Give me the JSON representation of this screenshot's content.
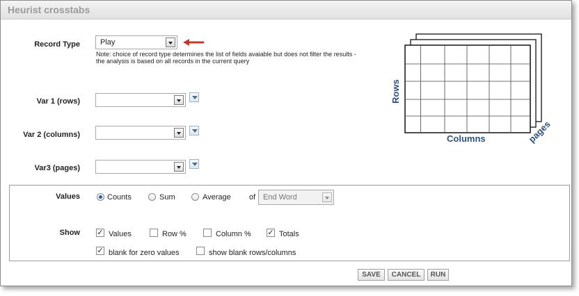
{
  "window": {
    "title": "Heurist crosstabs"
  },
  "record_type": {
    "label": "Record Type",
    "value": "Play",
    "note": "Note: choice of record type determines the list of fields avaiable but does not filter the results - the analysis is based on all records in the current query"
  },
  "vars": [
    {
      "label": "Var 1 (rows)",
      "value": ""
    },
    {
      "label": "Var 2 (columns)",
      "value": ""
    },
    {
      "label": "Var3 (pages)",
      "value": ""
    }
  ],
  "illustration": {
    "rows": "Rows",
    "columns": "Columns",
    "pages": "pages"
  },
  "values": {
    "label": "Values",
    "options": [
      "Counts",
      "Sum",
      "Average"
    ],
    "selected": "Counts",
    "of_label": "of",
    "field": "End Word"
  },
  "show": {
    "label": "Show",
    "options": [
      {
        "label": "Values",
        "checked": true
      },
      {
        "label": "Row %",
        "checked": false
      },
      {
        "label": "Column %",
        "checked": false
      },
      {
        "label": "Totals",
        "checked": true
      },
      {
        "label": "blank for zero values",
        "checked": true
      },
      {
        "label": "show blank rows/columns",
        "checked": false
      }
    ]
  },
  "buttons": {
    "save": "SAVE",
    "cancel": "CANCEL",
    "run": "RUN"
  },
  "colors": {
    "accent": "#2d4f7c",
    "arrow": "#c0392b"
  }
}
